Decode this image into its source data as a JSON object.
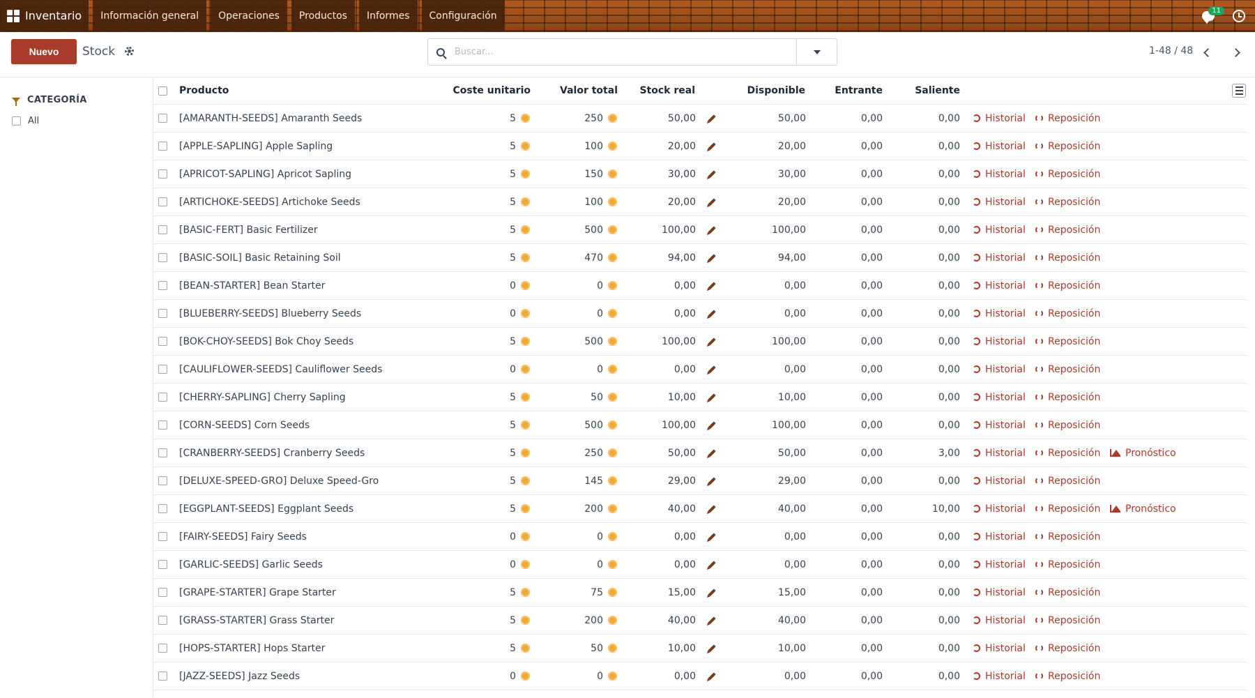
{
  "navbar": {
    "app_name": "Inventario",
    "menu": [
      "Información general",
      "Operaciones",
      "Productos",
      "Informes",
      "Configuración"
    ],
    "chat_count": "11",
    "bg_color": "#8f4d1d"
  },
  "control": {
    "new_label": "Nuevo",
    "breadcrumb": "Stock",
    "search_placeholder": "Buscar...",
    "pager": "1-48 / 48"
  },
  "sidepanel": {
    "title": "CATEGORÍA",
    "items": [
      "All"
    ]
  },
  "table": {
    "columns": [
      "Producto",
      "Coste unitario",
      "Valor total",
      "Stock real",
      "Disponible",
      "Entrante",
      "Saliente"
    ],
    "action_labels": {
      "history": "Historial",
      "replenish": "Reposición",
      "forecast": "Pronóstico"
    },
    "rows": [
      {
        "product": "[AMARANTH-SEEDS] Amaranth Seeds",
        "cost": "5",
        "value": "250",
        "stock": "50,00",
        "available": "50,00",
        "incoming": "0,00",
        "outgoing": "0,00",
        "forecast": false
      },
      {
        "product": "[APPLE-SAPLING] Apple Sapling",
        "cost": "5",
        "value": "100",
        "stock": "20,00",
        "available": "20,00",
        "incoming": "0,00",
        "outgoing": "0,00",
        "forecast": false
      },
      {
        "product": "[APRICOT-SAPLING] Apricot Sapling",
        "cost": "5",
        "value": "150",
        "stock": "30,00",
        "available": "30,00",
        "incoming": "0,00",
        "outgoing": "0,00",
        "forecast": false
      },
      {
        "product": "[ARTICHOKE-SEEDS] Artichoke Seeds",
        "cost": "5",
        "value": "100",
        "stock": "20,00",
        "available": "20,00",
        "incoming": "0,00",
        "outgoing": "0,00",
        "forecast": false
      },
      {
        "product": "[BASIC-FERT] Basic Fertilizer",
        "cost": "5",
        "value": "500",
        "stock": "100,00",
        "available": "100,00",
        "incoming": "0,00",
        "outgoing": "0,00",
        "forecast": false
      },
      {
        "product": "[BASIC-SOIL] Basic Retaining Soil",
        "cost": "5",
        "value": "470",
        "stock": "94,00",
        "available": "94,00",
        "incoming": "0,00",
        "outgoing": "0,00",
        "forecast": false
      },
      {
        "product": "[BEAN-STARTER] Bean Starter",
        "cost": "0",
        "value": "0",
        "stock": "0,00",
        "available": "0,00",
        "incoming": "0,00",
        "outgoing": "0,00",
        "forecast": false
      },
      {
        "product": "[BLUEBERRY-SEEDS] Blueberry Seeds",
        "cost": "0",
        "value": "0",
        "stock": "0,00",
        "available": "0,00",
        "incoming": "0,00",
        "outgoing": "0,00",
        "forecast": false
      },
      {
        "product": "[BOK-CHOY-SEEDS] Bok Choy Seeds",
        "cost": "5",
        "value": "500",
        "stock": "100,00",
        "available": "100,00",
        "incoming": "0,00",
        "outgoing": "0,00",
        "forecast": false
      },
      {
        "product": "[CAULIFLOWER-SEEDS] Cauliflower Seeds",
        "cost": "0",
        "value": "0",
        "stock": "0,00",
        "available": "0,00",
        "incoming": "0,00",
        "outgoing": "0,00",
        "forecast": false
      },
      {
        "product": "[CHERRY-SAPLING] Cherry Sapling",
        "cost": "5",
        "value": "50",
        "stock": "10,00",
        "available": "10,00",
        "incoming": "0,00",
        "outgoing": "0,00",
        "forecast": false
      },
      {
        "product": "[CORN-SEEDS] Corn Seeds",
        "cost": "5",
        "value": "500",
        "stock": "100,00",
        "available": "100,00",
        "incoming": "0,00",
        "outgoing": "0,00",
        "forecast": false
      },
      {
        "product": "[CRANBERRY-SEEDS] Cranberry Seeds",
        "cost": "5",
        "value": "250",
        "stock": "50,00",
        "available": "50,00",
        "incoming": "0,00",
        "outgoing": "3,00",
        "forecast": true
      },
      {
        "product": "[DELUXE-SPEED-GRO] Deluxe Speed-Gro",
        "cost": "5",
        "value": "145",
        "stock": "29,00",
        "available": "29,00",
        "incoming": "0,00",
        "outgoing": "0,00",
        "forecast": false
      },
      {
        "product": "[EGGPLANT-SEEDS] Eggplant Seeds",
        "cost": "5",
        "value": "200",
        "stock": "40,00",
        "available": "40,00",
        "incoming": "0,00",
        "outgoing": "10,00",
        "forecast": true
      },
      {
        "product": "[FAIRY-SEEDS] Fairy Seeds",
        "cost": "0",
        "value": "0",
        "stock": "0,00",
        "available": "0,00",
        "incoming": "0,00",
        "outgoing": "0,00",
        "forecast": false
      },
      {
        "product": "[GARLIC-SEEDS] Garlic Seeds",
        "cost": "0",
        "value": "0",
        "stock": "0,00",
        "available": "0,00",
        "incoming": "0,00",
        "outgoing": "0,00",
        "forecast": false
      },
      {
        "product": "[GRAPE-STARTER] Grape Starter",
        "cost": "5",
        "value": "75",
        "stock": "15,00",
        "available": "15,00",
        "incoming": "0,00",
        "outgoing": "0,00",
        "forecast": false
      },
      {
        "product": "[GRASS-STARTER] Grass Starter",
        "cost": "5",
        "value": "200",
        "stock": "40,00",
        "available": "40,00",
        "incoming": "0,00",
        "outgoing": "0,00",
        "forecast": false
      },
      {
        "product": "[HOPS-STARTER] Hops Starter",
        "cost": "5",
        "value": "50",
        "stock": "10,00",
        "available": "10,00",
        "incoming": "0,00",
        "outgoing": "0,00",
        "forecast": false
      },
      {
        "product": "[JAZZ-SEEDS] Jazz Seeds",
        "cost": "0",
        "value": "0",
        "stock": "0,00",
        "available": "0,00",
        "incoming": "0,00",
        "outgoing": "0,00",
        "forecast": false
      }
    ]
  }
}
